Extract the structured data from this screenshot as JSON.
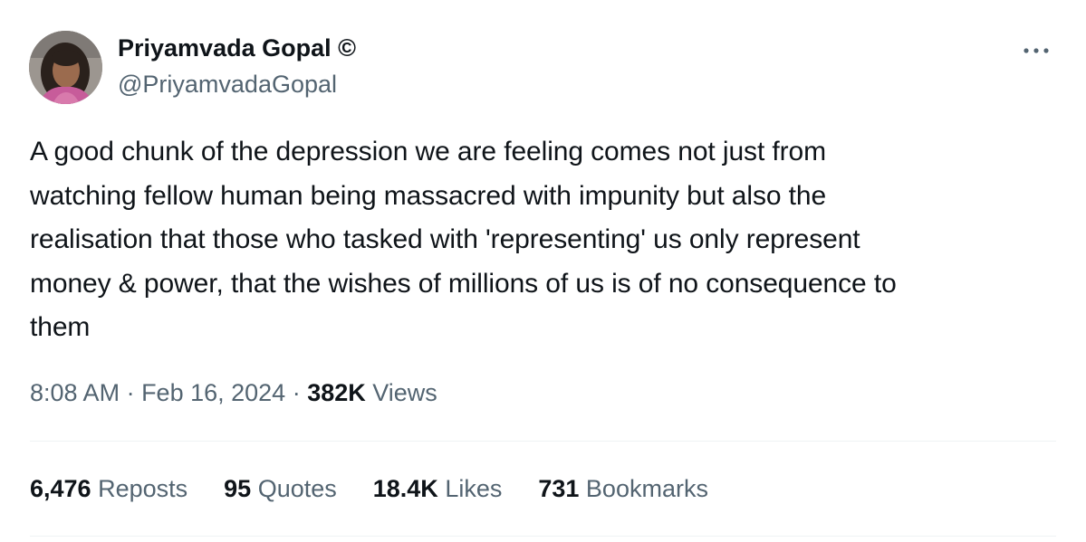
{
  "author": {
    "display_name": "Priyamvada Gopal ©",
    "handle": "@PriyamvadaGopal"
  },
  "more_icon": "more-horizontal-icon",
  "tweet": {
    "text": "A good chunk of the depression we are feeling comes not just from\nwatching fellow human being massacred with impunity but also the\nrealisation that those who tasked with 'representing' us only represent\nmoney & power, that the wishes of millions of us is of no consequence to\nthem"
  },
  "meta": {
    "time": "8:08 AM",
    "separator": " · ",
    "date": "Feb 16, 2024",
    "separator2": " · ",
    "views_count": "382K",
    "views_label": " Views"
  },
  "stats": {
    "reposts": {
      "count": "6,476",
      "label": " Reposts"
    },
    "quotes": {
      "count": "95",
      "label": " Quotes"
    },
    "likes": {
      "count": "18.4K",
      "label": " Likes"
    },
    "bookmarks": {
      "count": "731",
      "label": " Bookmarks"
    }
  },
  "colors": {
    "primary_text": "#0f1419",
    "secondary_text": "#536471",
    "divider": "#eff3f4"
  }
}
